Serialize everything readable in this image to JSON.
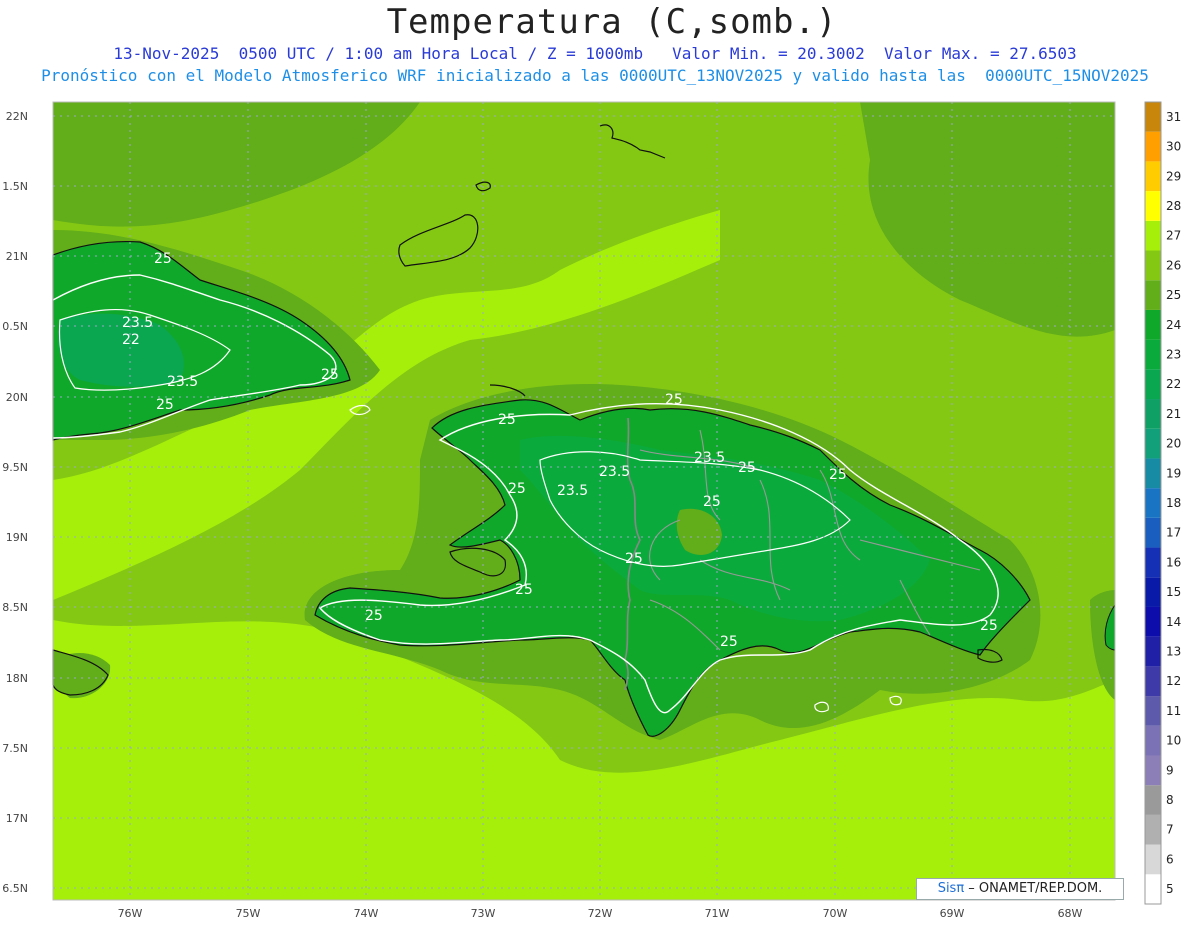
{
  "title": "Temperatura (C,somb.)",
  "subtitle_1": "13-Nov-2025  0500 UTC / 1:00 am Hora Local / Z = 1000mb   Valor Min. = 20.3002  Valor Max. = 27.6503",
  "subtitle_2": "Pronóstico con el Modelo Atmosferico WRF inicializado a las 0000UTC_13NOV2025 y valido hasta las  0000UTC_15NOV2025",
  "axes": {
    "lat_labels": [
      "22N",
      "1.5N",
      "21N",
      "0.5N",
      "20N",
      "9.5N",
      "19N",
      "8.5N",
      "18N",
      "7.5N",
      "17N",
      "6.5N"
    ],
    "lon_labels": [
      "76W",
      "75W",
      "74W",
      "73W",
      "72W",
      "71W",
      "70W",
      "69W",
      "68W"
    ]
  },
  "colorbar": {
    "levels": [
      "5",
      "6",
      "7",
      "8",
      "9",
      "10",
      "11",
      "12",
      "13",
      "14",
      "15",
      "16",
      "17",
      "18",
      "19",
      "20",
      "21",
      "22",
      "23",
      "24",
      "25",
      "26",
      "27",
      "28",
      "29",
      "30",
      "31"
    ],
    "colors": [
      "#ffffff",
      "#d8d8d8",
      "#b0b0b0",
      "#9a9a9a",
      "#8c7fb8",
      "#7a72b4",
      "#5e5aab",
      "#3e3aa8",
      "#2020a6",
      "#0d0dab",
      "#0a1aa8",
      "#1530b4",
      "#1a5ec0",
      "#1a74c4",
      "#178aa4",
      "#12a07a",
      "#0ea064",
      "#0aa650",
      "#0aaa3c",
      "#10a82a",
      "#62ad1a",
      "#84c814",
      "#a6ef0a",
      "#ffff00",
      "#ffcc00",
      "#ff9f00",
      "#c8870a"
    ]
  },
  "contour_labels": [
    {
      "text": "25"
    },
    {
      "text": "23.5"
    },
    {
      "text": "22"
    },
    {
      "text": "23.5"
    },
    {
      "text": "25"
    },
    {
      "text": "25"
    },
    {
      "text": "25"
    },
    {
      "text": "25"
    },
    {
      "text": "23.5"
    },
    {
      "text": "25"
    },
    {
      "text": "23.5"
    },
    {
      "text": "23.5"
    },
    {
      "text": "25"
    },
    {
      "text": "25"
    },
    {
      "text": "25"
    },
    {
      "text": "25"
    },
    {
      "text": "25"
    },
    {
      "text": "25"
    },
    {
      "text": "25"
    },
    {
      "text": "25"
    }
  ],
  "colors": {
    "bg_light": "#a6ef0a",
    "bg_mid": "#84c814",
    "bg_dark": "#62ad1a",
    "land_24": "#10a82a",
    "land_23": "#0aaa3c"
  },
  "credit": {
    "brand": "SisPI",
    "symbol": "π",
    "text": " – ONAMET/REP.DOM."
  }
}
